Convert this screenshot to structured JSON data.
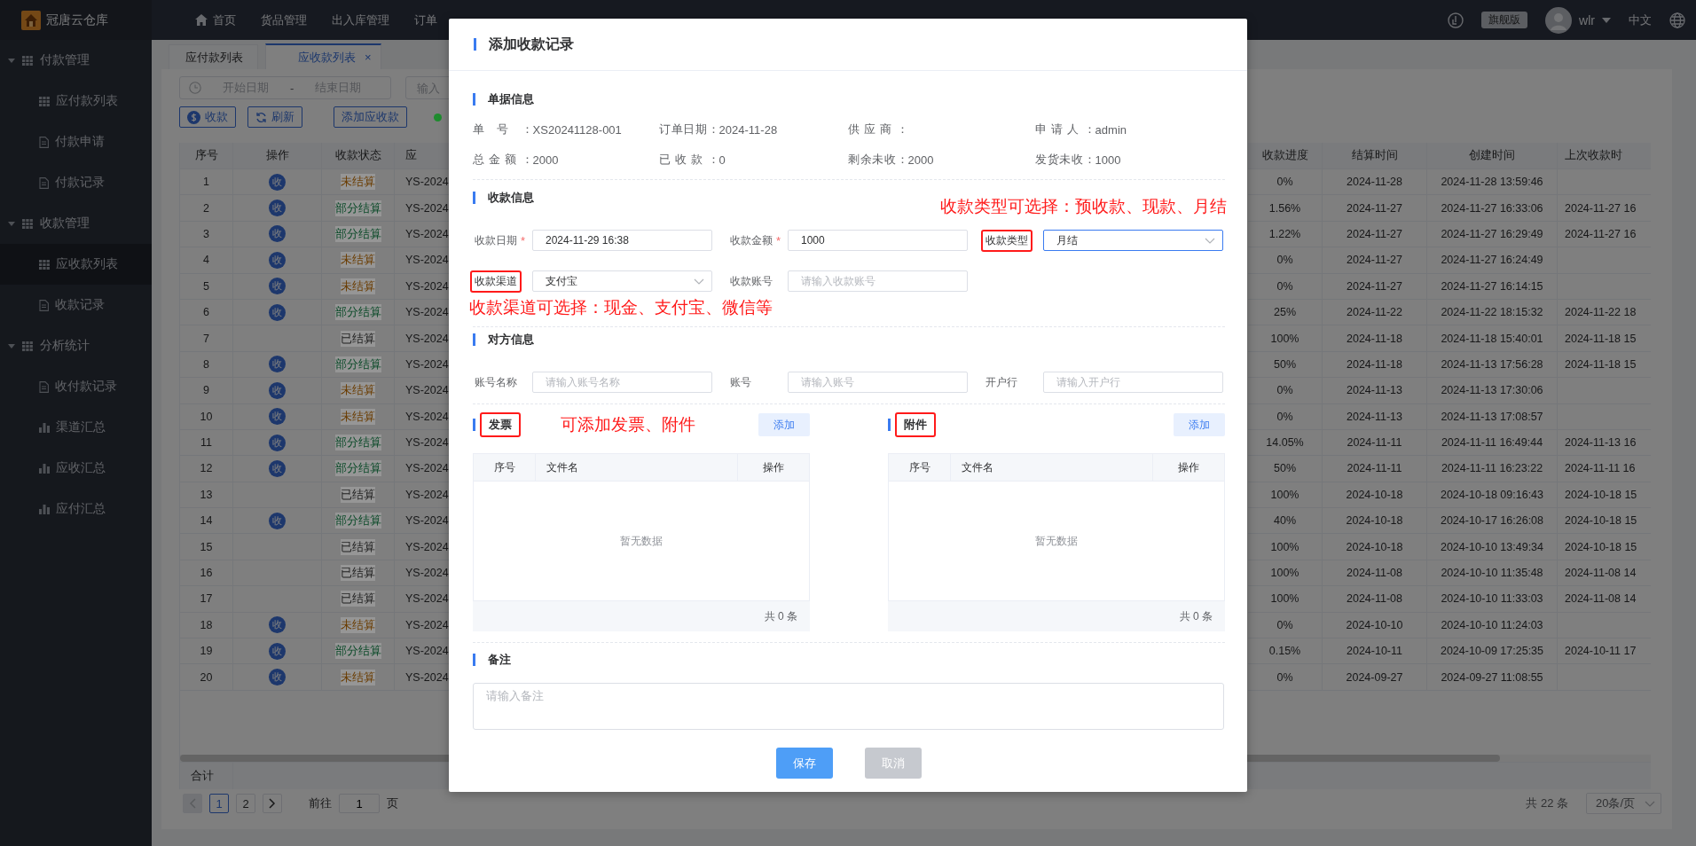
{
  "app": {
    "logo_text": "冠唐云仓库"
  },
  "top_nav": {
    "items": [
      {
        "label": "首页",
        "kind": "home"
      },
      {
        "label": "货品管理",
        "kind": "plain"
      },
      {
        "label": "出入库管理",
        "kind": "plain"
      },
      {
        "label": "订单",
        "kind": "plain"
      }
    ],
    "edition": "旗舰版",
    "user": "wlr",
    "language": "中文"
  },
  "sidebar": {
    "groups": [
      {
        "label": "付款管理",
        "expanded": true,
        "children": [
          {
            "label": "应付款列表",
            "kind": "grid",
            "selected": false
          },
          {
            "label": "付款申请",
            "kind": "document",
            "selected": false
          },
          {
            "label": "付款记录",
            "kind": "document",
            "selected": false
          }
        ]
      },
      {
        "label": "收款管理",
        "expanded": true,
        "children": [
          {
            "label": "应收款列表",
            "kind": "grid",
            "selected": true
          },
          {
            "label": "收款记录",
            "kind": "document",
            "selected": false
          }
        ]
      },
      {
        "label": "分析统计",
        "expanded": true,
        "children": [
          {
            "label": "收付款记录",
            "kind": "document",
            "selected": false
          },
          {
            "label": "渠道汇总",
            "kind": "chart",
            "selected": false
          },
          {
            "label": "应收汇总",
            "kind": "chart",
            "selected": false
          },
          {
            "label": "应付汇总",
            "kind": "chart",
            "selected": false
          }
        ]
      }
    ]
  },
  "tabs": [
    {
      "label": "应付款列表",
      "selected": false
    },
    {
      "label": "应收款列表",
      "selected": true,
      "close_glyph": "×"
    }
  ],
  "filter": {
    "start_placeholder": "开始日期",
    "separator": "-",
    "end_placeholder": "结束日期",
    "search_placeholder": "输入"
  },
  "toolbar": [
    {
      "label": "收款",
      "kind": "pay"
    },
    {
      "label": "刷新",
      "kind": "refresh"
    },
    {
      "label": "添加应收款",
      "kind": "plain"
    }
  ],
  "legend": {
    "color": "#1e8c2e"
  },
  "table": {
    "columns_left": [
      "序号",
      "操作",
      "收款状态",
      "应"
    ],
    "columns_right": [
      "收款进度",
      "结算时间",
      "创建时间",
      "上次收款时"
    ],
    "summary_label": "合计",
    "rows": [
      {
        "no": "1",
        "action": "收",
        "status": {
          "label": "未结算",
          "color": "#6a3c00"
        },
        "code": "YS-2024",
        "progress": "0%",
        "settle_date": "2024-11-28",
        "created": "2024-11-28 13:59:46"
      },
      {
        "no": "2",
        "action": "收",
        "status": {
          "label": "部分结算",
          "color": "#0a4a28"
        },
        "code": "YS-2024",
        "progress": "1.56%",
        "settle_date": "2024-11-27",
        "created": "2024-11-27 16:33:06",
        "last_paid": "2024-11-27 16"
      },
      {
        "no": "3",
        "action": "收",
        "status": {
          "label": "部分结算",
          "color": "#0a4a28"
        },
        "code": "YS-2024",
        "progress": "1.22%",
        "settle_date": "2024-11-27",
        "created": "2024-11-27 16:29:49",
        "last_paid": "2024-11-27 16"
      },
      {
        "no": "4",
        "action": "收",
        "status": {
          "label": "未结算",
          "color": "#6a3c00"
        },
        "code": "YS-2024",
        "progress": "0%",
        "settle_date": "2024-11-27",
        "created": "2024-11-27 16:24:49"
      },
      {
        "no": "5",
        "action": "收",
        "status": {
          "label": "未结算",
          "color": "#6a3c00"
        },
        "code": "YS-2024",
        "progress": "0%",
        "settle_date": "2024-11-27",
        "created": "2024-11-27 16:14:15"
      },
      {
        "no": "6",
        "action": "收",
        "status": {
          "label": "部分结算",
          "color": "#0a4a28"
        },
        "code": "YS-2024",
        "progress": "25%",
        "settle_date": "2024-11-22",
        "created": "2024-11-22 18:15:32",
        "last_paid": "2024-11-22 18"
      },
      {
        "no": "7",
        "status": {
          "label": "已结算",
          "color": "#1e1e1e"
        },
        "code": "YS-2024",
        "progress": "100%",
        "settle_date": "2024-11-18",
        "created": "2024-11-18 15:40:01",
        "last_paid": "2024-11-18 15"
      },
      {
        "no": "8",
        "action": "收",
        "status": {
          "label": "部分结算",
          "color": "#0a4a28"
        },
        "code": "YS-2024",
        "progress": "50%",
        "settle_date": "2024-11-18",
        "created": "2024-11-13 17:56:28",
        "last_paid": "2024-11-18 15"
      },
      {
        "no": "9",
        "action": "收",
        "status": {
          "label": "未结算",
          "color": "#6a3c00"
        },
        "code": "YS-2024",
        "progress": "0%",
        "settle_date": "2024-11-13",
        "created": "2024-11-13 17:30:06"
      },
      {
        "no": "10",
        "action": "收",
        "status": {
          "label": "未结算",
          "color": "#6a3c00"
        },
        "code": "YS-2024",
        "progress": "0%",
        "settle_date": "2024-11-13",
        "created": "2024-11-13 17:08:57"
      },
      {
        "no": "11",
        "action": "收",
        "status": {
          "label": "部分结算",
          "color": "#0a4a28"
        },
        "code": "YS-2024",
        "progress": "14.05%",
        "settle_date": "2024-11-11",
        "created": "2024-11-11 16:49:44",
        "last_paid": "2024-11-13 16"
      },
      {
        "no": "12",
        "action": "收",
        "status": {
          "label": "部分结算",
          "color": "#0a4a28"
        },
        "code": "YS-2024",
        "progress": "50%",
        "settle_date": "2024-11-11",
        "created": "2024-11-11 16:23:22",
        "last_paid": "2024-11-11 16"
      },
      {
        "no": "13",
        "status": {
          "label": "已结算",
          "color": "#1e1e1e"
        },
        "code": "YS-2024",
        "progress": "100%",
        "settle_date": "2024-10-18",
        "created": "2024-10-18 09:16:43",
        "last_paid": "2024-10-18 15"
      },
      {
        "no": "14",
        "action": "收",
        "status": {
          "label": "部分结算",
          "color": "#0a4a28"
        },
        "code": "YS-2024",
        "progress": "40%",
        "settle_date": "2024-10-18",
        "created": "2024-10-17 16:26:08",
        "last_paid": "2024-10-18 15"
      },
      {
        "no": "15",
        "status": {
          "label": "已结算",
          "color": "#1e1e1e"
        },
        "code": "YS-2024",
        "progress": "100%",
        "settle_date": "2024-10-18",
        "created": "2024-10-10 13:49:34",
        "last_paid": "2024-10-18 15"
      },
      {
        "no": "16",
        "status": {
          "label": "已结算",
          "color": "#1e1e1e"
        },
        "code": "YS-2024",
        "progress": "100%",
        "settle_date": "2024-11-08",
        "created": "2024-10-10 11:35:48",
        "last_paid": "2024-11-08 14"
      },
      {
        "no": "17",
        "status": {
          "label": "已结算",
          "color": "#1e1e1e"
        },
        "code": "YS-2024",
        "progress": "100%",
        "settle_date": "2024-11-08",
        "created": "2024-10-10 11:33:03",
        "last_paid": "2024-11-08 14"
      },
      {
        "no": "18",
        "action": "收",
        "status": {
          "label": "未结算",
          "color": "#6a3c00"
        },
        "code": "YS-2024",
        "progress": "0%",
        "settle_date": "2024-10-10",
        "created": "2024-10-10 11:24:03"
      },
      {
        "no": "19",
        "action": "收",
        "status": {
          "label": "部分结算",
          "color": "#0a4a28"
        },
        "code": "YS-2024",
        "progress": "0.15%",
        "settle_date": "2024-10-11",
        "created": "2024-10-09 17:25:35",
        "last_paid": "2024-10-11 17"
      },
      {
        "no": "20",
        "action": "收",
        "status": {
          "label": "未结算",
          "color": "#6a3c00"
        },
        "code": "YS-2024",
        "progress": "0%",
        "settle_date": "2024-09-27",
        "created": "2024-09-27 11:08:55"
      }
    ]
  },
  "pagination": {
    "prev_disabled": true,
    "pages": [
      {
        "label": "1",
        "selected": true
      },
      {
        "label": "2",
        "selected": false
      }
    ],
    "goto_label": "前往",
    "goto_value": "1",
    "page_label": "页",
    "total": "共 22 条",
    "page_size": "20条/页"
  },
  "modal": {
    "title": "添加收款记录",
    "doc_info": {
      "title": "单据信息",
      "fields": [
        {
          "label": "单号：",
          "value": "XS20241128-001"
        },
        {
          "label": "订单日期：",
          "value": "2024-11-28"
        },
        {
          "label": "供应商："
        },
        {
          "label": "申请人：",
          "value": "admin"
        },
        {
          "label": "总金额：",
          "value": "2000"
        },
        {
          "label": "已收款：",
          "value": "0"
        },
        {
          "label": "剩余未收：",
          "value": "2000"
        },
        {
          "label": "发货未收：",
          "value": "1000"
        }
      ]
    },
    "payment_info": {
      "title": "收款信息",
      "type_note": "收款类型可选择：预收款、现款、月结",
      "channel_note": "收款渠道可选择：现金、支付宝、微信等",
      "fields": [
        {
          "label": "收款日期",
          "required_mark": "*",
          "kind": "input",
          "value": "2024-11-29 16:38",
          "highlighted": false,
          "focused": false
        },
        {
          "label": "收款金额",
          "required_mark": "*",
          "kind": "input",
          "value": "1000",
          "highlighted": false,
          "focused": false
        },
        {
          "label": "收款类型",
          "kind": "select",
          "value": "月结",
          "highlighted": true,
          "focused": true
        },
        {
          "label": "收款渠道",
          "kind": "select",
          "value": "支付宝",
          "highlighted": true,
          "focused": false
        },
        {
          "label": "收款账号",
          "kind": "input",
          "placeholder": "请输入收款账号",
          "highlighted": false,
          "focused": false
        }
      ]
    },
    "party_info": {
      "title": "对方信息",
      "fields": [
        {
          "label": "账号名称",
          "kind": "input",
          "placeholder": "请输入账号名称",
          "highlighted": false,
          "focused": false
        },
        {
          "label": "账号",
          "kind": "input",
          "placeholder": "请输入账号",
          "highlighted": false,
          "focused": false
        },
        {
          "label": "开户行",
          "kind": "input",
          "placeholder": "请输入开户行",
          "highlighted": false,
          "focused": false
        }
      ]
    },
    "files_note": "可添加发票、附件",
    "file_panels": [
      {
        "title": "发票",
        "highlighted": true,
        "add_label": "添加",
        "columns": [
          "序号",
          "文件名",
          "操作"
        ],
        "empty_text": "暂无数据",
        "total": "共 0 条"
      },
      {
        "title": "附件",
        "highlighted": true,
        "add_label": "添加",
        "columns": [
          "序号",
          "文件名",
          "操作"
        ],
        "empty_text": "暂无数据",
        "total": "共 0 条"
      }
    ],
    "remark": {
      "title": "备注",
      "placeholder": "请输入备注"
    },
    "buttons": [
      {
        "label": "保存",
        "kind": "primary"
      },
      {
        "label": "取消",
        "kind": "disabled"
      }
    ]
  }
}
